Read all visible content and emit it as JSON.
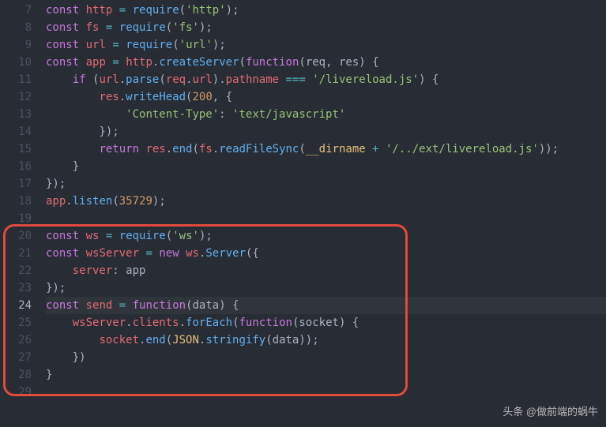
{
  "startLine": 7,
  "activeLine": 24,
  "watermark": "头条 @做前端的蜗牛",
  "lines": [
    [
      [
        "kw",
        "const"
      ],
      [
        "punct",
        " "
      ],
      [
        "ident",
        "http"
      ],
      [
        "punct",
        " "
      ],
      [
        "op",
        "="
      ],
      [
        "punct",
        " "
      ],
      [
        "fn",
        "require"
      ],
      [
        "punct",
        "("
      ],
      [
        "str",
        "'http'"
      ],
      [
        "punct",
        ");"
      ]
    ],
    [
      [
        "kw",
        "const"
      ],
      [
        "punct",
        " "
      ],
      [
        "ident",
        "fs"
      ],
      [
        "punct",
        " "
      ],
      [
        "op",
        "="
      ],
      [
        "punct",
        " "
      ],
      [
        "fn",
        "require"
      ],
      [
        "punct",
        "("
      ],
      [
        "str",
        "'fs'"
      ],
      [
        "punct",
        ");"
      ]
    ],
    [
      [
        "kw",
        "const"
      ],
      [
        "punct",
        " "
      ],
      [
        "ident",
        "url"
      ],
      [
        "punct",
        " "
      ],
      [
        "op",
        "="
      ],
      [
        "punct",
        " "
      ],
      [
        "fn",
        "require"
      ],
      [
        "punct",
        "("
      ],
      [
        "str",
        "'url'"
      ],
      [
        "punct",
        ");"
      ]
    ],
    [
      [
        "kw",
        "const"
      ],
      [
        "punct",
        " "
      ],
      [
        "ident",
        "app"
      ],
      [
        "punct",
        " "
      ],
      [
        "op",
        "="
      ],
      [
        "punct",
        " "
      ],
      [
        "ident",
        "http"
      ],
      [
        "punct",
        "."
      ],
      [
        "fn",
        "createServer"
      ],
      [
        "punct",
        "("
      ],
      [
        "kw",
        "function"
      ],
      [
        "punct",
        "("
      ],
      [
        "param",
        "req"
      ],
      [
        "punct",
        ", "
      ],
      [
        "param",
        "res"
      ],
      [
        "punct",
        ") {"
      ]
    ],
    [
      [
        "punct",
        "    "
      ],
      [
        "kw",
        "if"
      ],
      [
        "punct",
        " ("
      ],
      [
        "ident",
        "url"
      ],
      [
        "punct",
        "."
      ],
      [
        "fn",
        "parse"
      ],
      [
        "punct",
        "("
      ],
      [
        "ident",
        "req"
      ],
      [
        "punct",
        "."
      ],
      [
        "prop",
        "url"
      ],
      [
        "punct",
        ")."
      ],
      [
        "prop",
        "pathname"
      ],
      [
        "punct",
        " "
      ],
      [
        "op",
        "==="
      ],
      [
        "punct",
        " "
      ],
      [
        "str",
        "'/livereload.js'"
      ],
      [
        "punct",
        ") {"
      ]
    ],
    [
      [
        "punct",
        "        "
      ],
      [
        "ident",
        "res"
      ],
      [
        "punct",
        "."
      ],
      [
        "fn",
        "writeHead"
      ],
      [
        "punct",
        "("
      ],
      [
        "num",
        "200"
      ],
      [
        "punct",
        ", {"
      ]
    ],
    [
      [
        "punct",
        "            "
      ],
      [
        "str",
        "'Content-Type'"
      ],
      [
        "punct",
        ": "
      ],
      [
        "str",
        "'text/javascript'"
      ]
    ],
    [
      [
        "punct",
        "        });"
      ]
    ],
    [
      [
        "punct",
        "        "
      ],
      [
        "kw",
        "return"
      ],
      [
        "punct",
        " "
      ],
      [
        "ident",
        "res"
      ],
      [
        "punct",
        "."
      ],
      [
        "fn",
        "end"
      ],
      [
        "punct",
        "("
      ],
      [
        "ident",
        "fs"
      ],
      [
        "punct",
        "."
      ],
      [
        "fn",
        "readFileSync"
      ],
      [
        "punct",
        "("
      ],
      [
        "builtin",
        "__dirname"
      ],
      [
        "punct",
        " "
      ],
      [
        "op",
        "+"
      ],
      [
        "punct",
        " "
      ],
      [
        "str",
        "'/../ext/livereload.js'"
      ],
      [
        "punct",
        "));"
      ]
    ],
    [
      [
        "punct",
        "    }"
      ]
    ],
    [
      [
        "punct",
        "});"
      ]
    ],
    [
      [
        "ident",
        "app"
      ],
      [
        "punct",
        "."
      ],
      [
        "fn",
        "listen"
      ],
      [
        "punct",
        "("
      ],
      [
        "num",
        "35729"
      ],
      [
        "punct",
        ");"
      ]
    ],
    [],
    [
      [
        "kw",
        "const"
      ],
      [
        "punct",
        " "
      ],
      [
        "ident",
        "ws"
      ],
      [
        "punct",
        " "
      ],
      [
        "op",
        "="
      ],
      [
        "punct",
        " "
      ],
      [
        "fn",
        "require"
      ],
      [
        "punct",
        "("
      ],
      [
        "str",
        "'ws'"
      ],
      [
        "punct",
        ");"
      ]
    ],
    [
      [
        "kw",
        "const"
      ],
      [
        "punct",
        " "
      ],
      [
        "ident",
        "wsServer"
      ],
      [
        "punct",
        " "
      ],
      [
        "op",
        "="
      ],
      [
        "punct",
        " "
      ],
      [
        "kw",
        "new"
      ],
      [
        "punct",
        " "
      ],
      [
        "ident",
        "ws"
      ],
      [
        "punct",
        "."
      ],
      [
        "fn",
        "Server"
      ],
      [
        "punct",
        "({"
      ]
    ],
    [
      [
        "punct",
        "    "
      ],
      [
        "cprop",
        "server"
      ],
      [
        "punct",
        ": "
      ],
      [
        "param",
        "app"
      ]
    ],
    [
      [
        "punct",
        "});"
      ]
    ],
    [
      [
        "kw",
        "const"
      ],
      [
        "punct",
        " "
      ],
      [
        "ident",
        "send"
      ],
      [
        "punct",
        " "
      ],
      [
        "op",
        "="
      ],
      [
        "punct",
        " "
      ],
      [
        "kw",
        "function"
      ],
      [
        "punct",
        "("
      ],
      [
        "param",
        "data"
      ],
      [
        "punct",
        ") {"
      ]
    ],
    [
      [
        "punct",
        "    "
      ],
      [
        "ident",
        "wsServer"
      ],
      [
        "punct",
        "."
      ],
      [
        "prop",
        "clients"
      ],
      [
        "punct",
        "."
      ],
      [
        "fn",
        "forEach"
      ],
      [
        "punct",
        "("
      ],
      [
        "kw",
        "function"
      ],
      [
        "punct",
        "("
      ],
      [
        "param",
        "socket"
      ],
      [
        "punct",
        ") {"
      ]
    ],
    [
      [
        "punct",
        "        "
      ],
      [
        "ident",
        "socket"
      ],
      [
        "punct",
        "."
      ],
      [
        "fn",
        "end"
      ],
      [
        "punct",
        "("
      ],
      [
        "builtin",
        "JSON"
      ],
      [
        "punct",
        "."
      ],
      [
        "fn",
        "stringify"
      ],
      [
        "punct",
        "("
      ],
      [
        "param",
        "data"
      ],
      [
        "punct",
        "));"
      ]
    ],
    [
      [
        "punct",
        "    })"
      ]
    ],
    [
      [
        "punct",
        "}"
      ]
    ],
    []
  ]
}
